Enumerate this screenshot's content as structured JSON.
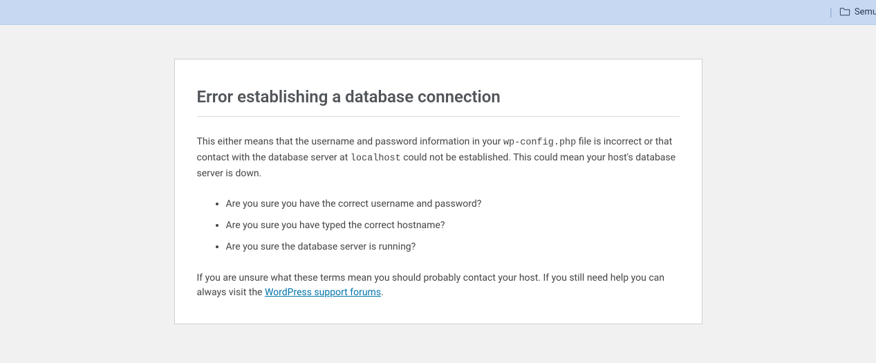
{
  "topbar": {
    "folder_label": "Semu"
  },
  "error": {
    "title": "Error establishing a database connection",
    "p1_a": "This either means that the username and password information in your ",
    "p1_code1": "wp-config.php",
    "p1_b": " file is incorrect or that contact with the database server at ",
    "p1_code2": "localhost",
    "p1_c": " could not be established. This could mean your host's database server is down.",
    "checks": [
      "Are you sure you have the correct username and password?",
      "Are you sure you have typed the correct hostname?",
      "Are you sure the database server is running?"
    ],
    "p2_a": "If you are unsure what these terms mean you should probably contact your host. If you still need help you can always visit the ",
    "p2_link": "WordPress support forums",
    "p2_b": "."
  }
}
